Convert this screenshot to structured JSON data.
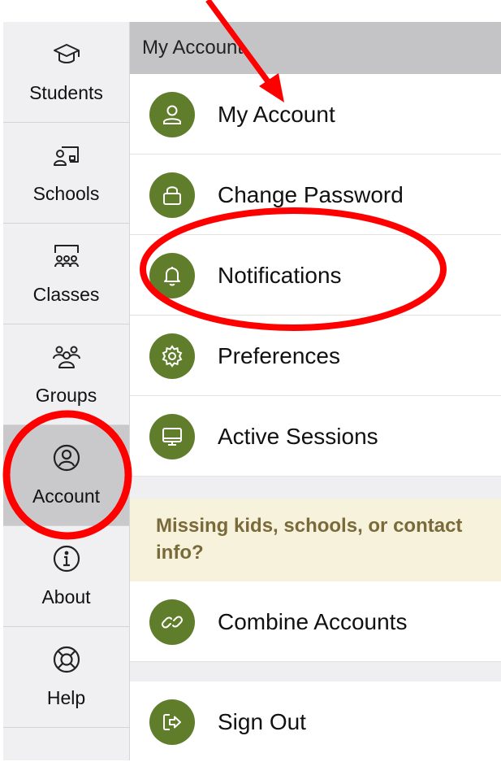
{
  "sidebar": {
    "items": [
      {
        "label": "Students",
        "icon": "graduation-cap-icon"
      },
      {
        "label": "Schools",
        "icon": "school-board-icon"
      },
      {
        "label": "Classes",
        "icon": "classroom-icon"
      },
      {
        "label": "Groups",
        "icon": "group-icon"
      },
      {
        "label": "Account",
        "icon": "user-circle-icon",
        "active": true
      },
      {
        "label": "About",
        "icon": "info-icon"
      },
      {
        "label": "Help",
        "icon": "lifebuoy-icon"
      }
    ]
  },
  "main": {
    "header": "My Account",
    "rows": [
      {
        "label": "My Account",
        "icon": "user-icon"
      },
      {
        "label": "Change Password",
        "icon": "lock-icon"
      },
      {
        "label": "Notifications",
        "icon": "bell-icon"
      },
      {
        "label": "Preferences",
        "icon": "gear-icon"
      },
      {
        "label": "Active Sessions",
        "icon": "monitor-icon"
      }
    ],
    "banner": "Missing kids, schools, or contact info?",
    "combine": {
      "label": "Combine Accounts",
      "icon": "link-icon"
    },
    "signout": {
      "label": "Sign Out",
      "icon": "sign-out-icon"
    }
  },
  "colors": {
    "accent_green": "#5f7d2b",
    "annotation_red": "#ff0000",
    "banner_bg": "#f7f2dc",
    "banner_text": "#7a6a3a",
    "sidebar_active": "#c9c9cb"
  }
}
